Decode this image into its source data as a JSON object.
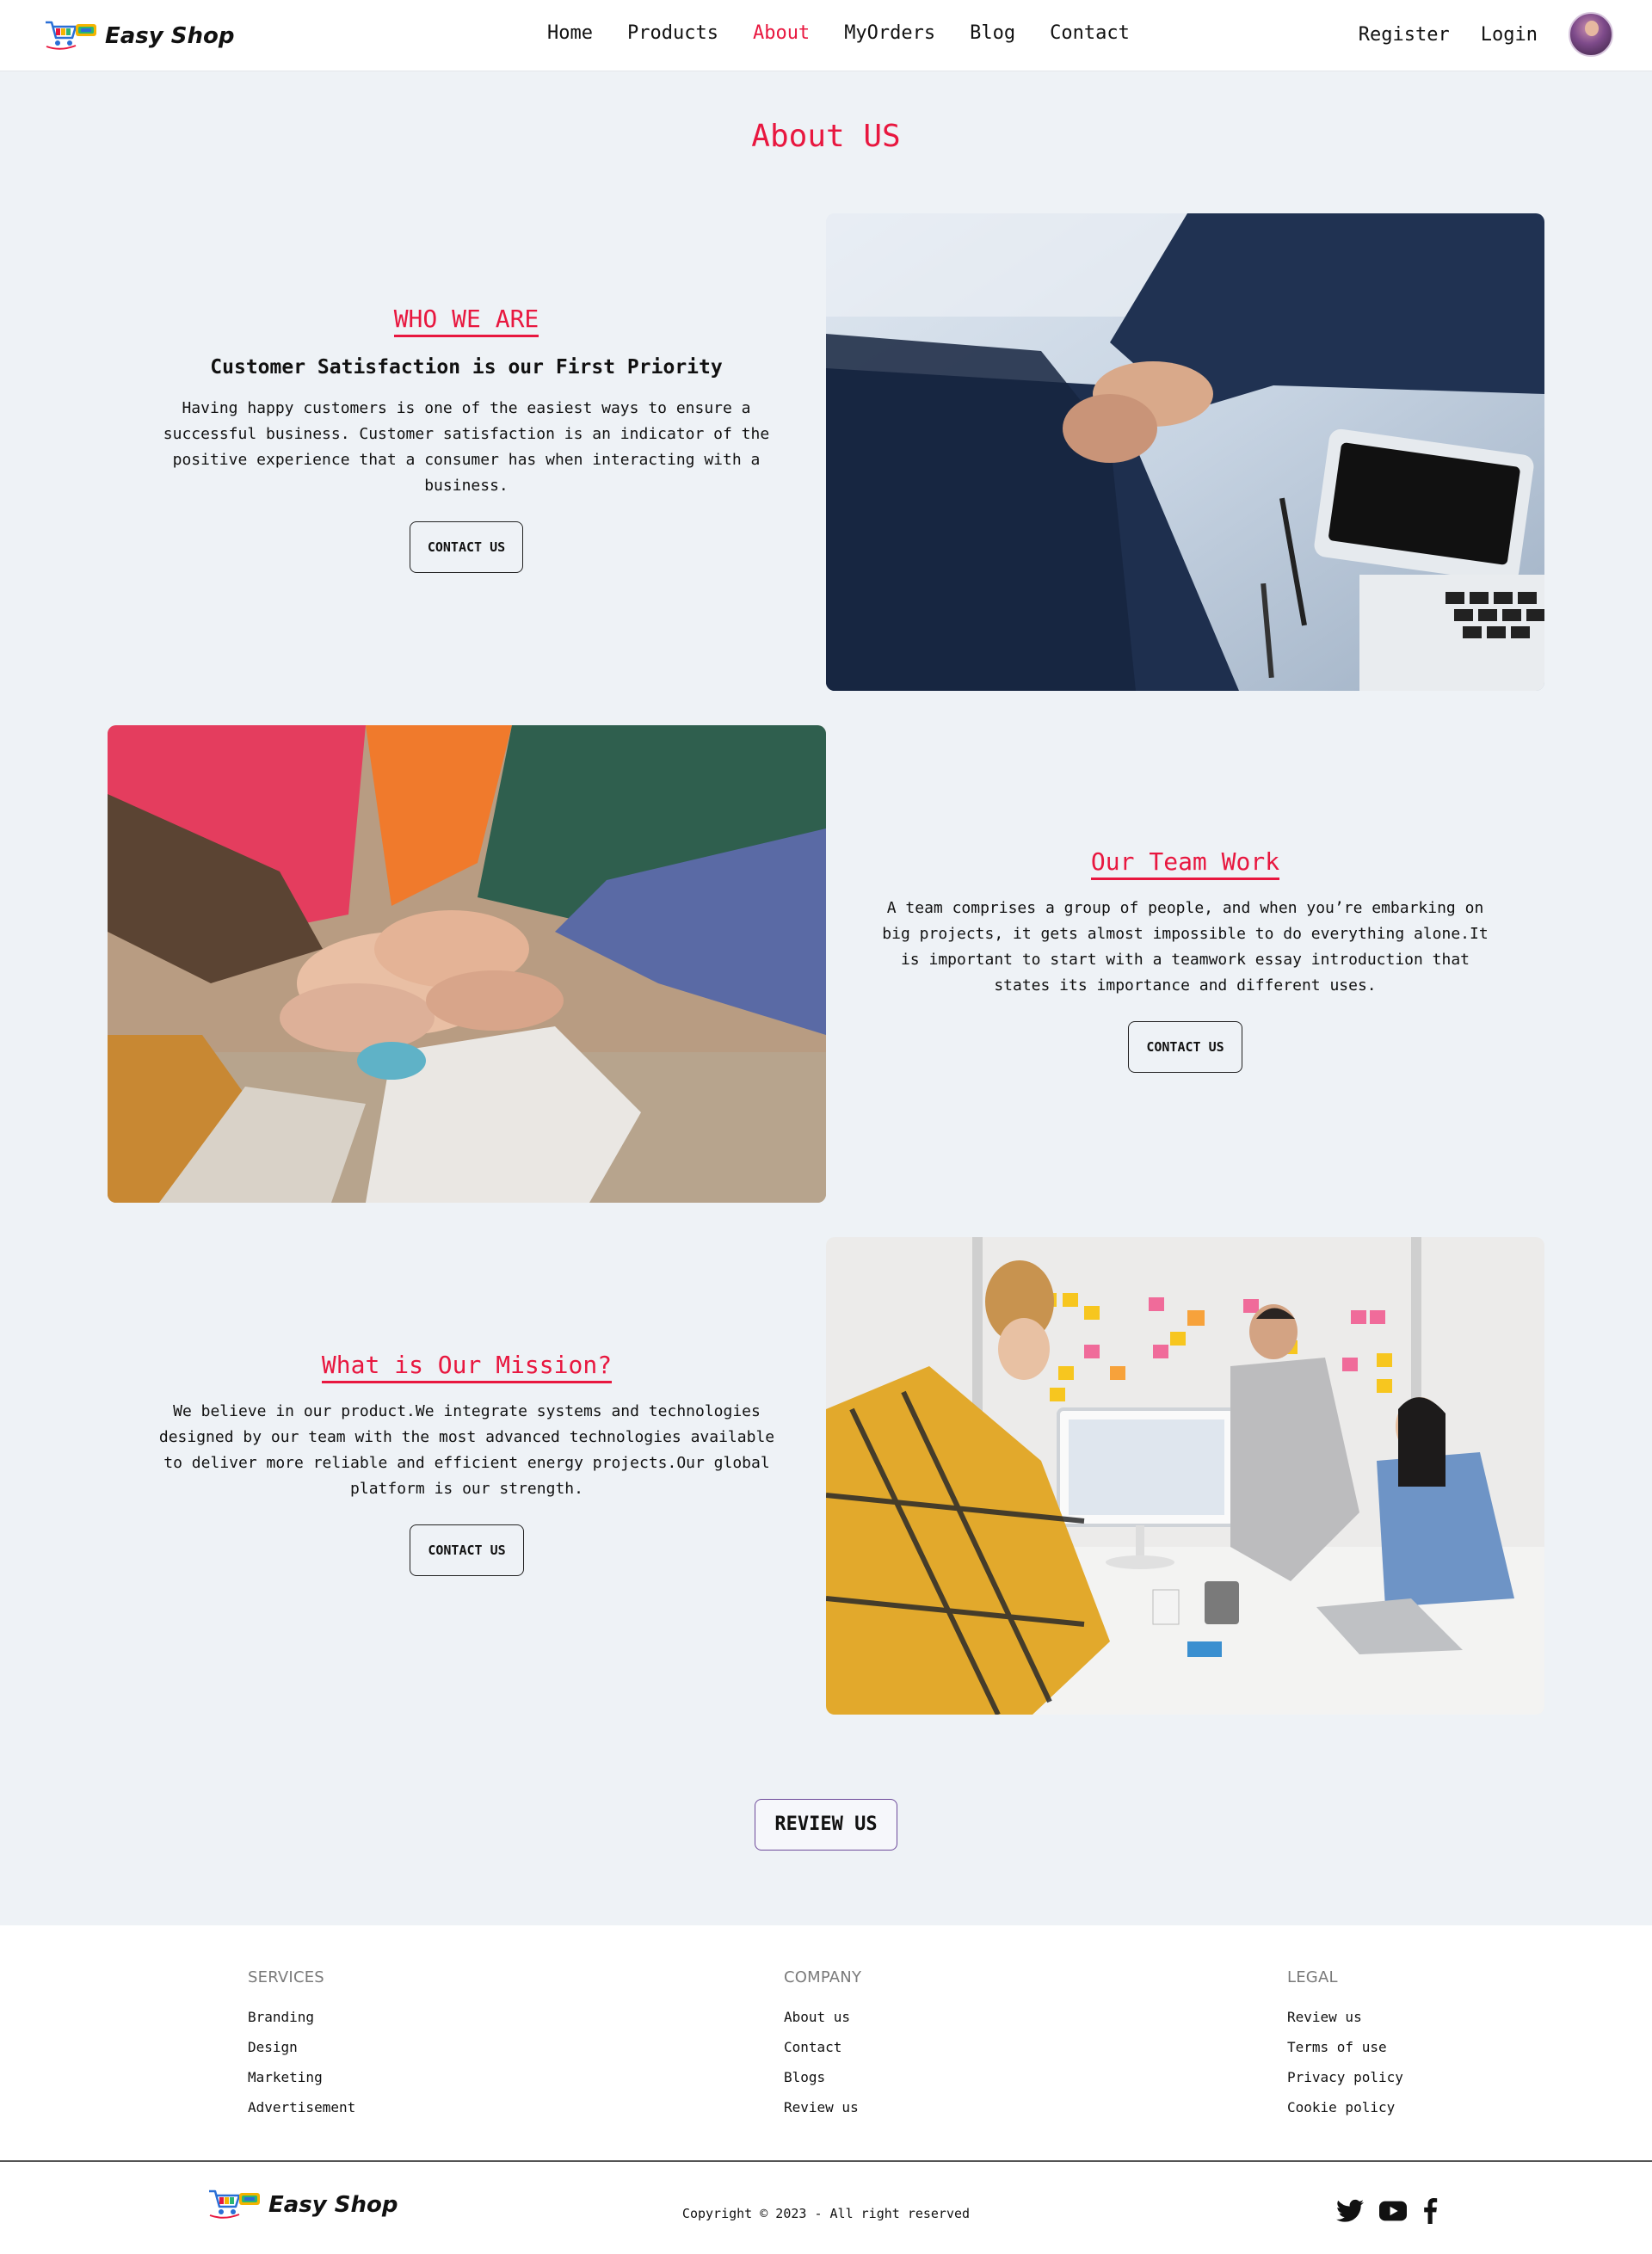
{
  "nav": {
    "brand": "Easy Shop",
    "links": [
      "Home",
      "Products",
      "About",
      "MyOrders",
      "Blog",
      "Contact"
    ],
    "active": "About",
    "register": "Register",
    "login": "Login",
    "accent_color": "#e8173f"
  },
  "page": {
    "title": "About US"
  },
  "sections": [
    {
      "heading": "WHO WE ARE",
      "subheading": "Customer Satisfaction is our First Priority",
      "body": "Having happy customers is one of the easiest ways to ensure a successful business. Customer satisfaction is an indicator of the positive experience that a consumer has when interacting with a business.",
      "button": "CONTACT US",
      "image": "business-handshake-photo"
    },
    {
      "heading": "Our Team Work",
      "body": "A team comprises a group of people, and when you’re embarking on big projects, it gets almost impossible to do everything alone.It is important to start with a teamwork essay introduction that states its importance and different uses.",
      "button": "CONTACT US",
      "image": "team-hands-stacked-photo"
    },
    {
      "heading": "What is Our Mission?",
      "body": "We believe in our product.We integrate systems and technologies designed by our team with the most advanced technologies available to deliver more reliable and efficient energy projects.Our global platform is our strength.",
      "button": "CONTACT US",
      "image": "office-meeting-photo"
    }
  ],
  "review": {
    "label": "REVIEW US"
  },
  "footer": {
    "columns": [
      {
        "title": "SERVICES",
        "links": [
          "Branding",
          "Design",
          "Marketing",
          "Advertisement"
        ]
      },
      {
        "title": "COMPANY",
        "links": [
          "About us",
          "Contact",
          "Blogs",
          "Review us"
        ]
      },
      {
        "title": "LEGAL",
        "links": [
          "Review us",
          "Terms of use",
          "Privacy policy",
          "Cookie policy"
        ]
      }
    ],
    "brand": "Easy Shop",
    "copyright": "Copyright © 2023 - All right reserved",
    "social": [
      "twitter-icon",
      "youtube-icon",
      "facebook-icon"
    ]
  }
}
